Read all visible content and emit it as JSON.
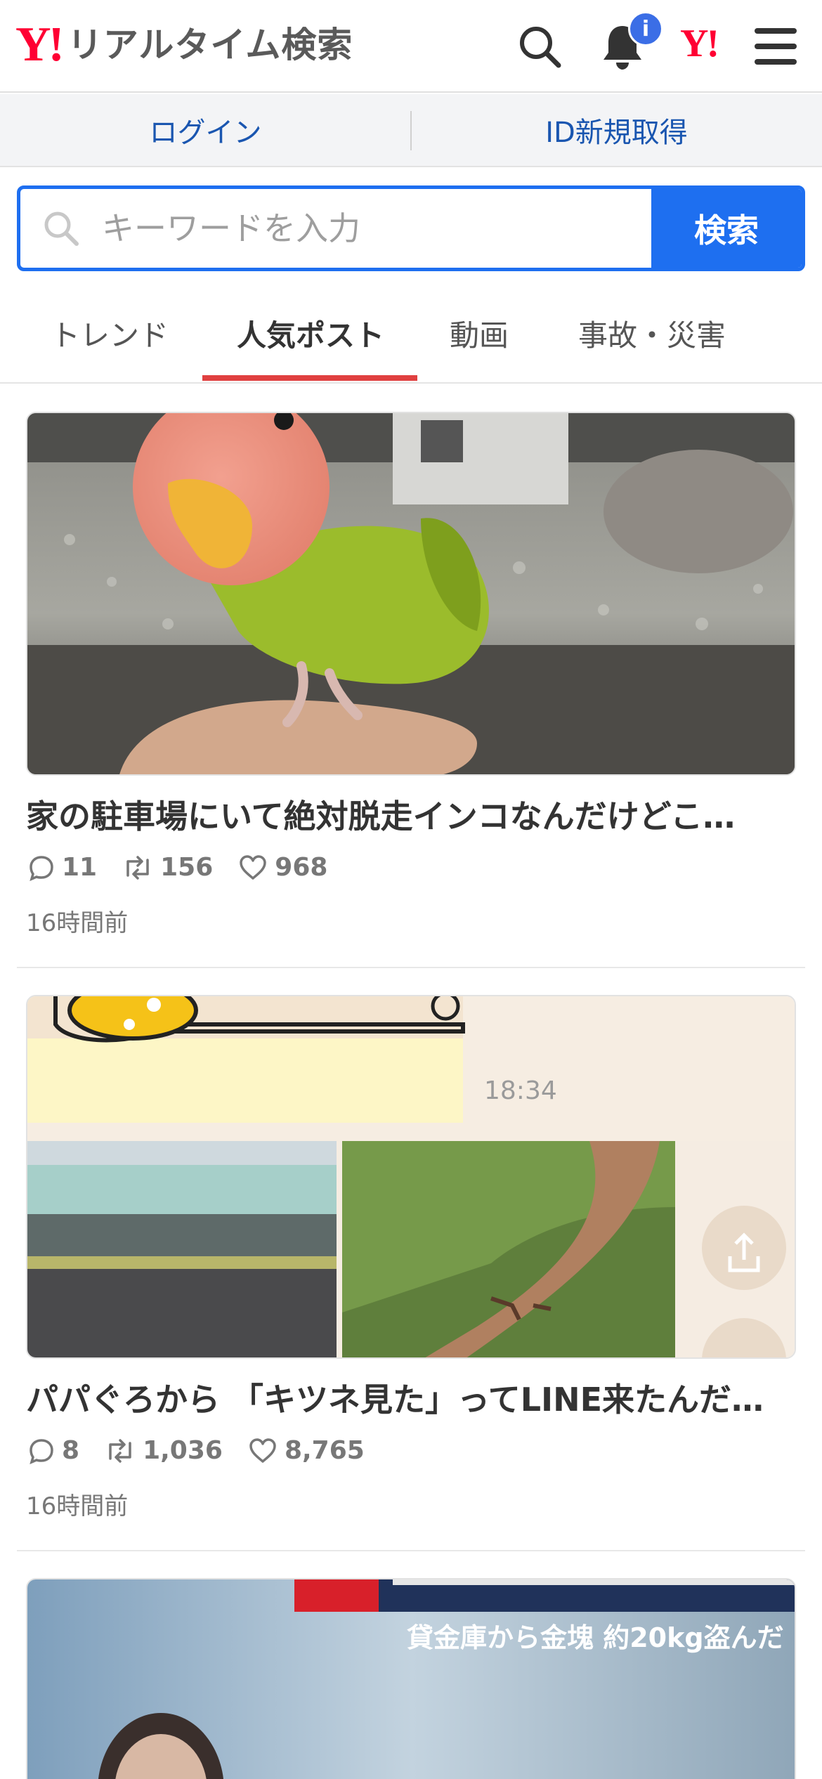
{
  "header": {
    "logo_y": "Y!",
    "logo_text": "リアルタイム検索",
    "search_icon": "search-icon",
    "bell_icon": "bell-icon",
    "badge": "i",
    "yahoo_mini": "Y!",
    "menu_icon": "hamburger-menu-icon"
  },
  "account": {
    "login": "ログイン",
    "register": "ID新規取得"
  },
  "search": {
    "placeholder": "キーワードを入力",
    "button": "検索"
  },
  "tabs": [
    {
      "label": "トレンド",
      "active": false
    },
    {
      "label": "人気ポスト",
      "active": true
    },
    {
      "label": "動画",
      "active": false
    },
    {
      "label": "事故・災害",
      "active": false
    }
  ],
  "posts": [
    {
      "title": "家の駐車場にいて絶対脱走インコなんだけどこ…",
      "replies": "11",
      "reposts": "156",
      "likes": "968",
      "time": "16時間前"
    },
    {
      "title": "パパぐろから 「キツネ見た」ってLINE来たんだ…",
      "replies": "8",
      "reposts": "1,036",
      "likes": "8,765",
      "time": "16時間前",
      "chat_time": "18:34"
    },
    {
      "headline_overlay": "貸金庫から金塊 約20kg盗んだ"
    }
  ],
  "colors": {
    "brand_red": "#ff0033",
    "accent_blue": "#1e6ff0",
    "link_blue": "#1a56b0",
    "tab_indicator": "#e04040"
  }
}
